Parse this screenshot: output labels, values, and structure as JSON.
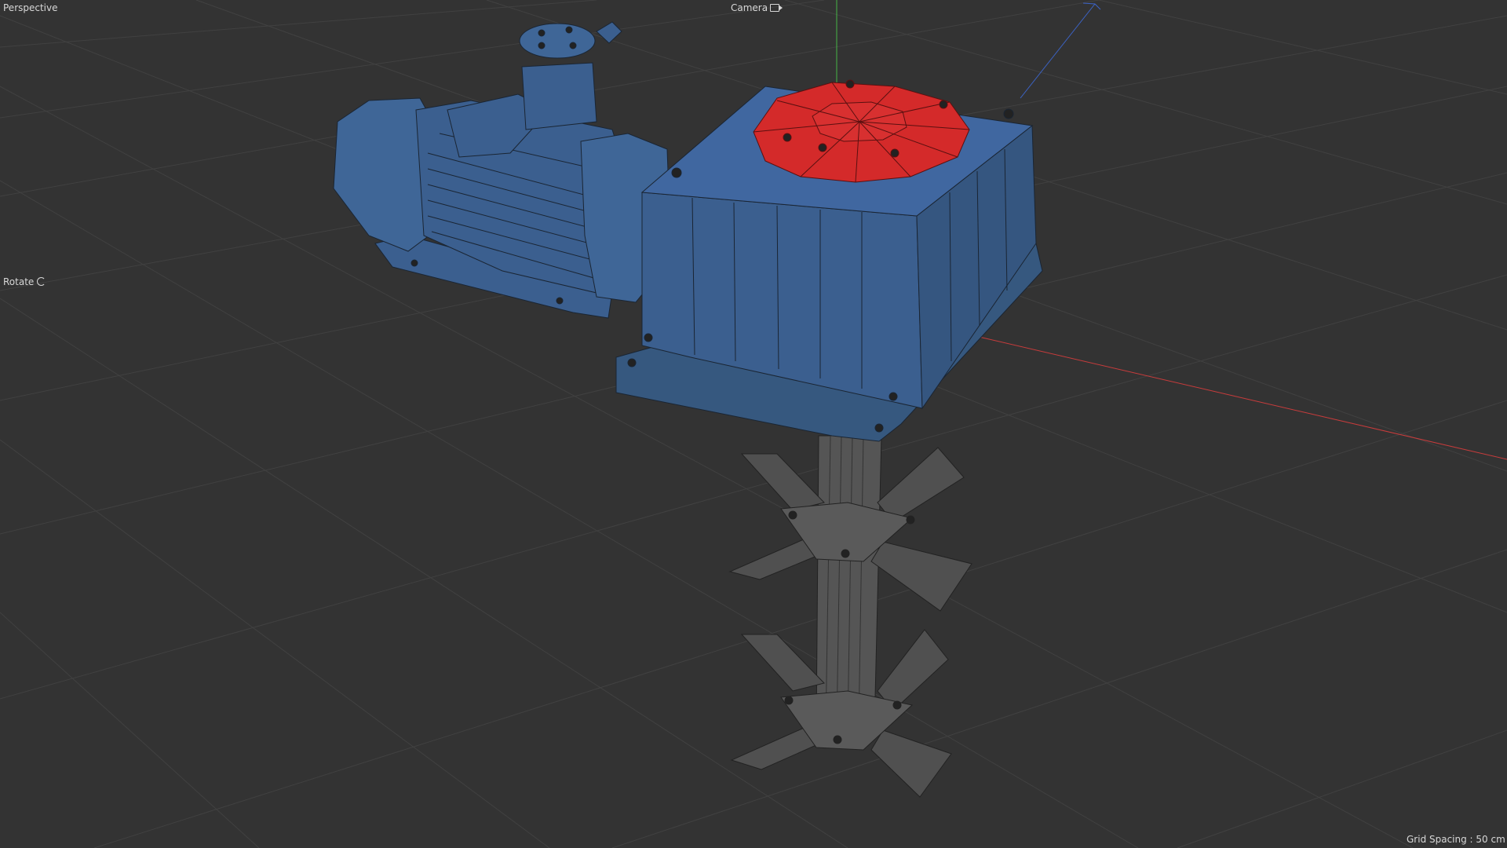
{
  "viewport": {
    "view_name": "Perspective",
    "camera_label": "Camera",
    "navigation_mode": "Rotate",
    "grid_spacing_label": "Grid Spacing : 50 cm"
  },
  "scene": {
    "selected_part_color": "#d42a2a",
    "model_color": "#3b5f8f",
    "agitator_color": "#555555",
    "background_color": "#333333",
    "grid_color": "#414141",
    "axis_x_color": "#c83c3c",
    "axis_y_color": "#46b446",
    "axis_z_color": "#3c64c8"
  }
}
